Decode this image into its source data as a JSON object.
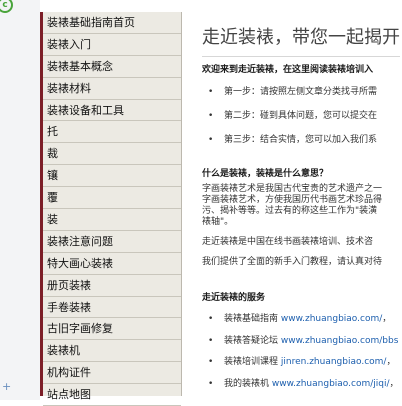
{
  "sidebar": {
    "items": [
      "装裱基础指南首页",
      "装裱入门",
      "装裱基本概念",
      "装裱材料",
      "装裱设备和工具",
      "托",
      "裁",
      "镶",
      "覆",
      "装",
      "装裱注意问题",
      "特大画心装裱",
      "册页装裱",
      "手卷装裱",
      "古旧字画修复",
      "装裱机",
      "机构证件",
      "站点地图"
    ]
  },
  "main": {
    "headline": "走近装裱，带您一起揭开",
    "welcome": "欢迎来到走近装裱，在这里阅读装裱培训入",
    "steps": [
      "第一步：请按照左侧文章分类找寻所需",
      "第二步：碰到具体问题，您可以提交在",
      "第三步：结合实情，您可以加入我们系"
    ],
    "what_title": "什么是装裱，装裱是什么意思？",
    "what_lines": [
      "字画装裱艺术是我国古代宝贵的艺术遗产之一",
      "字画装裱艺术，方使我国历代书画艺术珍品得",
      "污、揭补等等。过去有的称这些工作为\"装潢",
      "裱轴\"。"
    ],
    "para2": "走近装裱是中国在线书画装裱培训、技术咨",
    "para3": "我们提供了全面的新手入门教程，请认真对待",
    "services_title": "走近装裱的服务",
    "services": [
      {
        "label": "装裱基础指南",
        "url": "www.zhuangbiao.com/",
        "tail": "，"
      },
      {
        "label": "装裱答疑论坛",
        "url": "www.zhuangbiao.com/bbs",
        "tail": ""
      },
      {
        "label": "装裱培训课程",
        "url": "jinren.zhuangbiao.com/",
        "tail": "，"
      },
      {
        "label": "我的装裱机",
        "url": "www.zhuangbiao.com/jiqi/",
        "tail": "，"
      }
    ]
  },
  "colors": {
    "sidebar_bg": "#eceae3",
    "sidebar_accent": "#7c1e27",
    "link": "#1d5fae"
  },
  "icons": {
    "corner": "circle-icon",
    "corner_glyph": "c",
    "bottom": "plus-icon",
    "bottom_glyph": "+"
  }
}
